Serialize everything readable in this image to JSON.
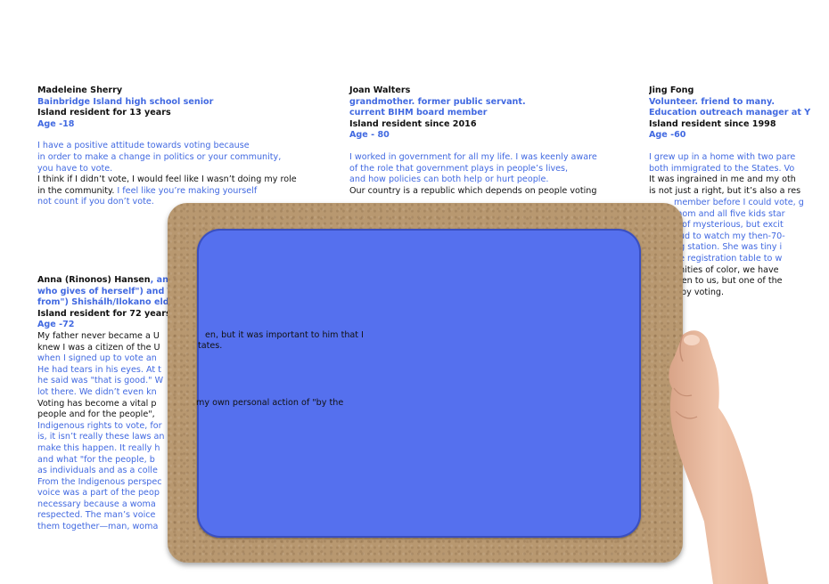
{
  "profiles": {
    "madeleine": {
      "name": "Madeleine Sherry",
      "role": "Bainbridge Island high school senior",
      "residence": "Island resident for 13 years",
      "age": "Age -18",
      "lines": [
        {
          "t": "I have a positive attitude towards voting because",
          "c": "blue"
        },
        {
          "t": "in order to make a change in politics or your community,",
          "c": "blue"
        },
        {
          "t": "you have to vote.",
          "c": "blue"
        },
        {
          "t": "I think if I didn’t vote, I would feel like I wasn’t doing my role",
          "c": "black"
        },
        {
          "t": "in the community. ",
          "c": "black",
          "t2": "I feel like you’re making yourself"
        },
        {
          "t": "not count if you don’t vote.",
          "c": "blue"
        }
      ]
    },
    "joan": {
      "name": "Joan Walters",
      "role_1": "grandmother. former public servant.",
      "role_2": "current BIHM board member",
      "residence": "Island resident since 2016",
      "age": "Age - 80",
      "lines": [
        {
          "t": "I worked in government for all my life. I was keenly aware",
          "c": "blue"
        },
        {
          "t": "of the role that government plays in people’s lives,",
          "c": "blue"
        },
        {
          "t": "and how policies can both help or hurt people.",
          "c": "blue"
        },
        {
          "t": "Our country is a republic which depends on people voting",
          "c": "black"
        }
      ]
    },
    "jing": {
      "name": "Jing Fong",
      "role_1": "Volunteer. friend to many.",
      "role_2": "Education outreach manager at Y",
      "residence": "Island resident since 1998",
      "age": "Age -60",
      "lines": [
        {
          "t": "I grew up in a home with two pare",
          "c": "blue"
        },
        {
          "t": "both immigrated to the States. Vo",
          "c": "blue"
        },
        {
          "t": "It was ingrained in me and my oth",
          "c": "black"
        },
        {
          "t": "is not just a right, but it’s also a res",
          "c": "black"
        }
      ],
      "peek_lines": [
        {
          "t": "member before I could vote, g",
          "c": "blue"
        },
        {
          "t": "mom and all five kids star",
          "c": "blue"
        },
        {
          "t": "d of mysterious, but excit",
          "c": "blue"
        },
        {
          "t": "oud to watch my then-70-",
          "c": "blue"
        },
        {
          "t": "ng station. She was tiny i",
          "c": "blue"
        },
        {
          "t": "he registration table to w",
          "c": "blue"
        },
        {
          "t": "unities of color, we have",
          "c": "black"
        },
        {
          "t": "sten to us, but one of the",
          "c": "black"
        },
        {
          "t": "s by voting.",
          "c": "black"
        }
      ]
    },
    "anna": {
      "name": "Anna (Rinonos) Hansen",
      "name_suffix": ", anc",
      "role_1": "who gives of herself\") and Tl",
      "role_2": "from\") Shishálh/Ilokano elde",
      "residence": "Island resident for 72 years",
      "age": "Age -72",
      "lines": [
        {
          "t": "My father never became a U",
          "c": "black"
        },
        {
          "t": "knew I was a citizen of the U",
          "c": "black"
        },
        {
          "t": "when I signed up to vote an",
          "c": "blue"
        },
        {
          "t": "He had tears in his eyes. At t",
          "c": "blue"
        },
        {
          "t": "he said was \"that is good.\" W",
          "c": "blue"
        },
        {
          "t": "lot there. We didn’t even kn",
          "c": "blue"
        },
        {
          "t": "Voting has become a vital p",
          "c": "black"
        },
        {
          "t": "people and for the people\",",
          "c": "black"
        },
        {
          "t": "Indigenous rights to vote, for",
          "c": "blue"
        },
        {
          "t": "is, it isn’t really these laws an",
          "c": "blue"
        },
        {
          "t": "make this happen. It really h",
          "c": "blue"
        },
        {
          "t": "and what \"for the people, b",
          "c": "blue"
        },
        {
          "t": "as individuals and as a colle",
          "c": "blue"
        },
        {
          "t": "From the Indigenous perspec",
          "c": "blue"
        },
        {
          "t": "voice was a part of the peop",
          "c": "blue"
        },
        {
          "t": "necessary because a woma",
          "c": "blue"
        },
        {
          "t": "respected. The man’s voice",
          "c": "blue"
        },
        {
          "t": "them together—man, woma",
          "c": "blue"
        }
      ],
      "overlay_1": "en, but it was important to him that I",
      "overlay_2": "tates.",
      "overlay_3": "my own personal action of \"by the"
    }
  },
  "colors": {
    "accent_blue": "#4169e1",
    "screen": "#5570ee",
    "board": "#b89870"
  }
}
